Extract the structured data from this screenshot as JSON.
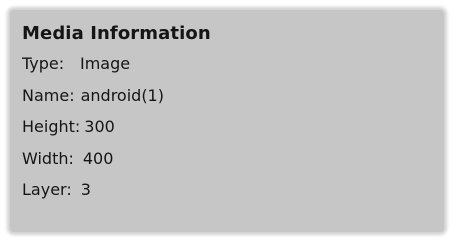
{
  "panel": {
    "title": "Media Information",
    "rows": [
      {
        "label": "Type:",
        "value": "Image"
      },
      {
        "label": "Name:",
        "value": "android(1)"
      },
      {
        "label": "Height:",
        "value": "300"
      },
      {
        "label": "Width:",
        "value": "400"
      },
      {
        "label": "Layer:",
        "value": "3"
      }
    ]
  },
  "colors": {
    "panel_background": "#c6c6c6",
    "text": "#151515",
    "page_background": "#ffffff"
  }
}
